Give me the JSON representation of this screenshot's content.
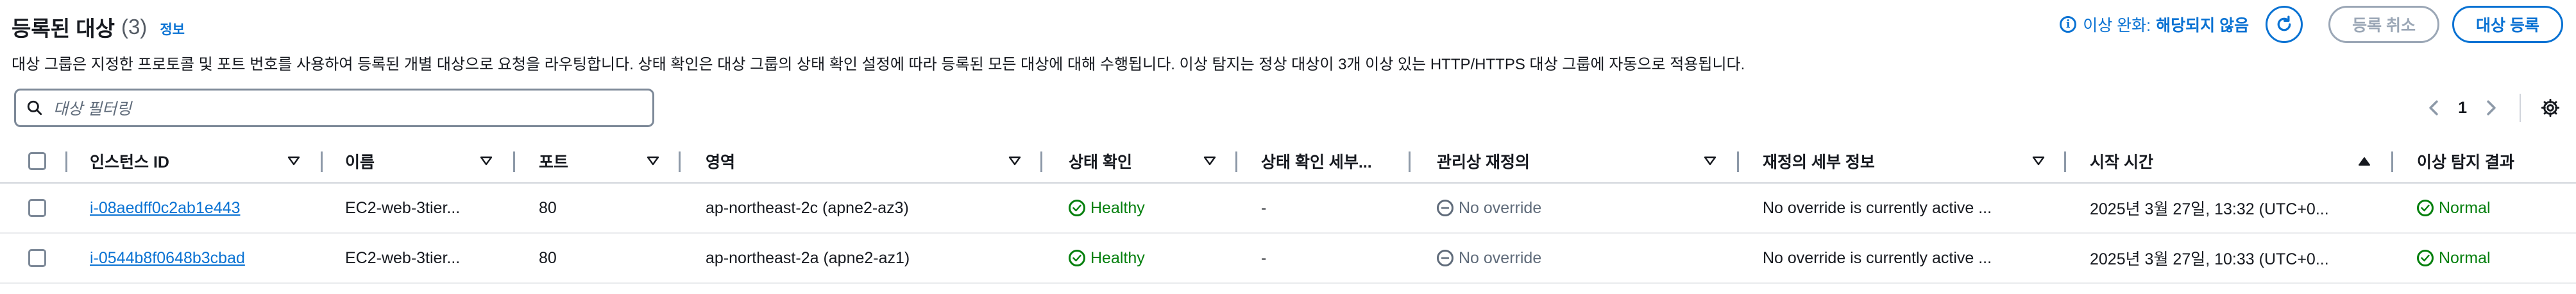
{
  "header": {
    "title": "등록된 대상",
    "count": "(3)",
    "info_link": "정보",
    "description": "대상 그룹은 지정한 프로토콜 및 포트 번호를 사용하여 등록된 개별 대상으로 요청을 라우팅합니다. 상태 확인은 대상 그룹의 상태 확인 설정에 따라 등록된 모든 대상에 대해 수행됩니다. 이상 탐지는 정상 대상이 3개 이상 있는 HTTP/HTTPS 대상 그룹에 자동으로 적용됩니다.",
    "anomaly_label": "이상 완화:",
    "anomaly_value": "해당되지 않음",
    "deregister_label": "등록 취소",
    "register_label": "대상 등록"
  },
  "filter": {
    "placeholder": "대상 필터링"
  },
  "pagination": {
    "current_page": "1"
  },
  "table": {
    "columns": [
      "인스턴스 ID",
      "이름",
      "포트",
      "영역",
      "상태 확인",
      "상태 확인 세부...",
      "관리상 재정의",
      "재정의 세부 정보",
      "시작 시간",
      "이상 탐지 결과"
    ],
    "rows": [
      {
        "instance_id": "i-08aedff0c2ab1e443",
        "name": "EC2-web-3tier...",
        "port": "80",
        "zone": "ap-northeast-2c (apne2-az3)",
        "health": "Healthy",
        "health_detail": "-",
        "override": "No override",
        "override_detail": "No override is currently active ...",
        "launch_time": "2025년 3월 27일, 13:32 (UTC+0...",
        "anomaly": "Normal"
      },
      {
        "instance_id": "i-0544b8f0648b3cbad",
        "name": "EC2-web-3tier...",
        "port": "80",
        "zone": "ap-northeast-2a (apne2-az1)",
        "health": "Healthy",
        "health_detail": "-",
        "override": "No override",
        "override_detail": "No override is currently active ...",
        "launch_time": "2025년 3월 27일, 10:33 (UTC+0...",
        "anomaly": "Normal"
      }
    ]
  },
  "colors": {
    "accent": "#0972d3",
    "success": "#037f0c",
    "muted": "#5f6b7a"
  },
  "icons": [
    "info-icon",
    "refresh-icon",
    "search-icon",
    "chevron-left-icon",
    "chevron-right-icon",
    "settings-icon",
    "sort-icon",
    "check-circle-icon",
    "minus-circle-icon"
  ]
}
